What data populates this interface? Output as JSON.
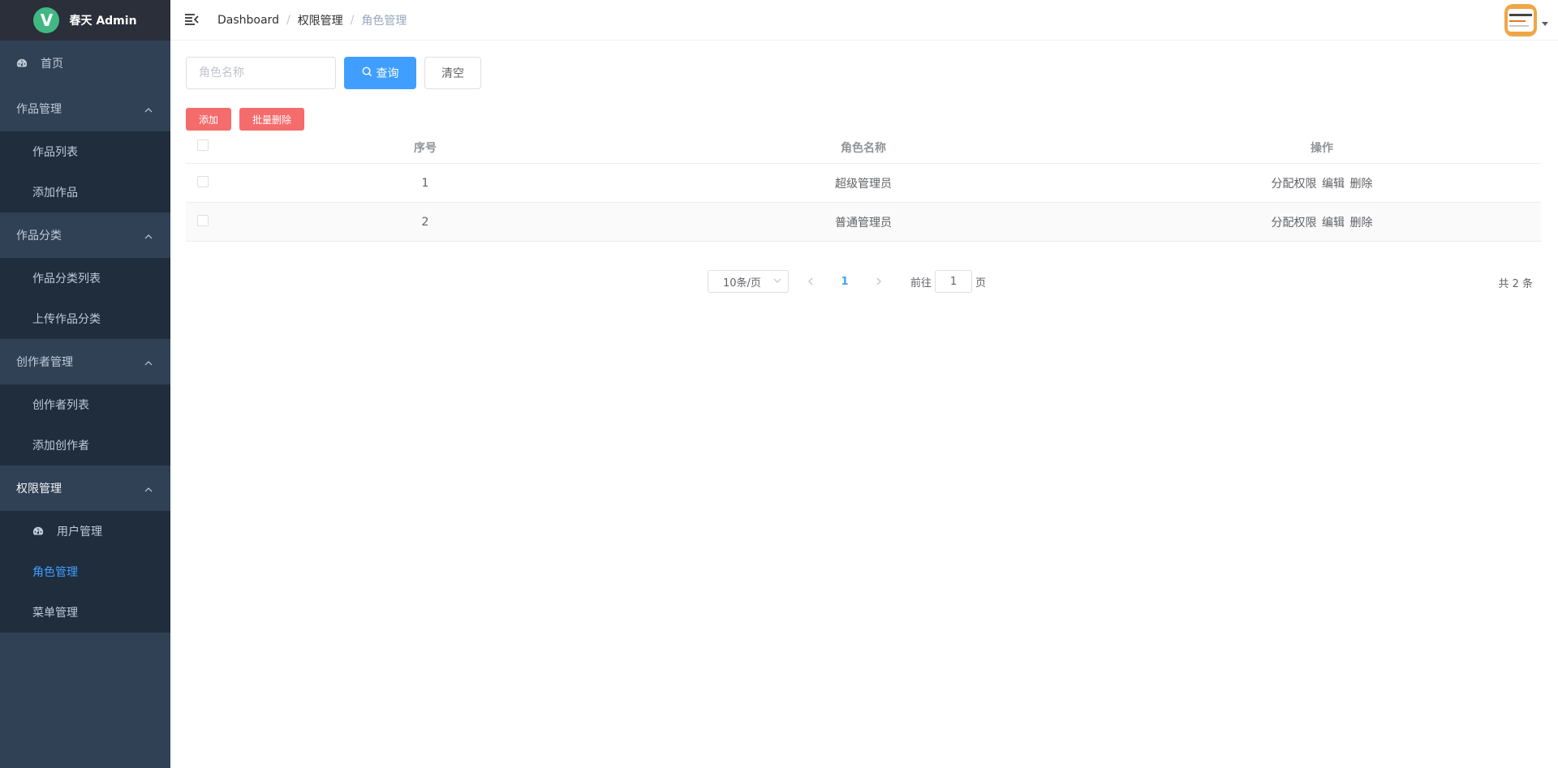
{
  "app": {
    "logo_letter": "V",
    "title": "春天 Admin"
  },
  "sidebar": {
    "home": {
      "label": "首页",
      "icon": "dashboard-icon"
    },
    "groups": [
      {
        "title": "作品管理",
        "items": [
          {
            "label": "作品列表"
          },
          {
            "label": "添加作品"
          }
        ]
      },
      {
        "title": "作品分类",
        "items": [
          {
            "label": "作品分类列表"
          },
          {
            "label": "上传作品分类"
          }
        ]
      },
      {
        "title": "创作者管理",
        "items": [
          {
            "label": "创作者列表"
          },
          {
            "label": "添加创作者"
          }
        ]
      },
      {
        "title": "权限管理",
        "items": [
          {
            "label": "用户管理",
            "icon": "dashboard-icon"
          },
          {
            "label": "角色管理",
            "selected": true
          },
          {
            "label": "菜单管理"
          }
        ]
      }
    ]
  },
  "header": {
    "breadcrumb": [
      "Dashboard",
      "权限管理",
      "角色管理"
    ],
    "separator": "/"
  },
  "search": {
    "placeholder": "角色名称",
    "query_label": "查询",
    "clear_label": "清空"
  },
  "actions": {
    "add_label": "添加",
    "batch_delete_label": "批量删除"
  },
  "table": {
    "columns": [
      "序号",
      "角色名称",
      "操作"
    ],
    "rows": [
      {
        "index": "1",
        "name": "超级管理员",
        "ops": [
          "分配权限",
          "编辑",
          "删除"
        ]
      },
      {
        "index": "2",
        "name": "普通管理员",
        "ops": [
          "分配权限",
          "编辑",
          "删除"
        ]
      }
    ]
  },
  "pagination": {
    "page_size": "10条/页",
    "current_page": "1",
    "goto_prefix": "前往",
    "goto_value": "1",
    "goto_suffix": "页",
    "total": "共 2 条"
  },
  "colors": {
    "sidebar_bg": "#304156",
    "submenu_bg": "#1f2d3d",
    "accent": "#409eff",
    "danger": "#f56c6c"
  }
}
